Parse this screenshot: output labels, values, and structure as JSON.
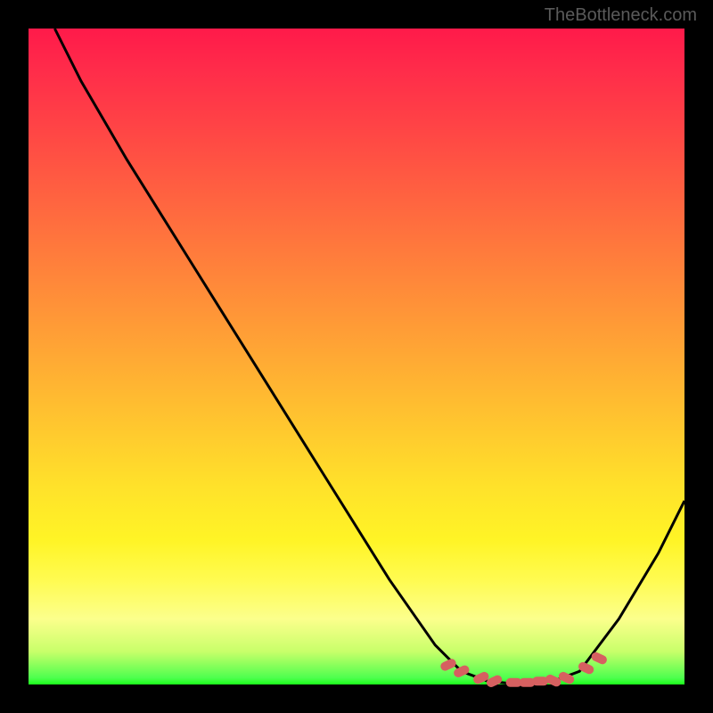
{
  "watermark": "TheBottleneck.com",
  "chart_data": {
    "type": "line",
    "title": "",
    "xlabel": "",
    "ylabel": "",
    "xlim": [
      0,
      100
    ],
    "ylim": [
      0,
      100
    ],
    "curve": [
      {
        "x": 4,
        "y": 100
      },
      {
        "x": 8,
        "y": 92
      },
      {
        "x": 15,
        "y": 80
      },
      {
        "x": 25,
        "y": 64
      },
      {
        "x": 35,
        "y": 48
      },
      {
        "x": 45,
        "y": 32
      },
      {
        "x": 55,
        "y": 16
      },
      {
        "x": 62,
        "y": 6
      },
      {
        "x": 66,
        "y": 2
      },
      {
        "x": 70,
        "y": 0.5
      },
      {
        "x": 75,
        "y": 0
      },
      {
        "x": 80,
        "y": 0.5
      },
      {
        "x": 84,
        "y": 2
      },
      {
        "x": 90,
        "y": 10
      },
      {
        "x": 96,
        "y": 20
      },
      {
        "x": 100,
        "y": 28
      }
    ],
    "markers": [
      {
        "x": 64,
        "y": 3
      },
      {
        "x": 66,
        "y": 2
      },
      {
        "x": 69,
        "y": 1
      },
      {
        "x": 71,
        "y": 0.5
      },
      {
        "x": 74,
        "y": 0.3
      },
      {
        "x": 76,
        "y": 0.3
      },
      {
        "x": 78,
        "y": 0.5
      },
      {
        "x": 80,
        "y": 0.6
      },
      {
        "x": 82,
        "y": 1
      },
      {
        "x": 85,
        "y": 2.5
      },
      {
        "x": 87,
        "y": 4
      }
    ],
    "marker_color": "#d66060",
    "curve_color": "#000000"
  }
}
